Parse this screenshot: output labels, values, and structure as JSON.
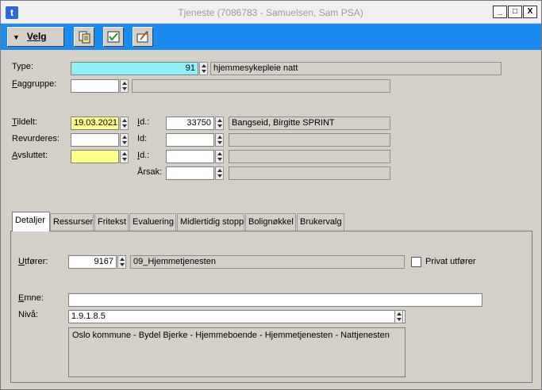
{
  "window": {
    "title": "Tjeneste (7086783 - Samuelsen, Sam PSA)",
    "app_icon": "t"
  },
  "titlebar_buttons": {
    "minimize": "_",
    "maximize": "□",
    "close": "X"
  },
  "toolbar": {
    "velg_label": "Velg",
    "icons": [
      "copy-icon",
      "checkmark-icon",
      "edit-icon"
    ]
  },
  "form": {
    "type_label": "Type:",
    "type_value": "91",
    "type_desc": "hjemmesykepleie natt",
    "faggruppe_label": "Faggruppe:",
    "faggruppe_value": "",
    "faggruppe_desc": "",
    "tildelt_label": "Tildelt:",
    "tildelt_value": "19.03.2021",
    "tildelt_id_label": "Id.:",
    "tildelt_id_value": "33750",
    "tildelt_id_desc": "Bangseid, Birgitte SPRINT",
    "revurderes_label": "Revurderes:",
    "revurderes_value": "",
    "revurderes_id_label": "Id:",
    "revurderes_id_value": "",
    "revurderes_id_desc": "",
    "avsluttet_label": "Avsluttet:",
    "avsluttet_value": "",
    "avsluttet_id_label": "Id.:",
    "avsluttet_id_value": "",
    "avsluttet_id_desc": "",
    "arsak_label": "Årsak:",
    "arsak_value": "",
    "arsak_desc": ""
  },
  "tabs": [
    {
      "label": "Detaljer",
      "active": true
    },
    {
      "label": "Ressurser",
      "active": false
    },
    {
      "label": "Fritekst",
      "active": false
    },
    {
      "label": "Evaluering",
      "active": false
    },
    {
      "label": "Midlertidig stopp",
      "active": false
    },
    {
      "label": "Bolignøkkel",
      "active": false
    },
    {
      "label": "Brukervalg",
      "active": false
    }
  ],
  "details": {
    "utforer_label": "Utfører:",
    "utforer_value": "9167",
    "utforer_desc": "09_Hjemmetjenesten",
    "privat_utforer_label": "Privat utfører",
    "privat_utforer_checked": false,
    "emne_label": "Emne:",
    "emne_value": "",
    "niva_label": "Nivå:",
    "niva_value": "1.9.1.8.5",
    "niva_path": "Oslo kommune - Bydel Bjerke - Hjemmeboende - Hjemmetjenesten - Nattjenesten"
  }
}
